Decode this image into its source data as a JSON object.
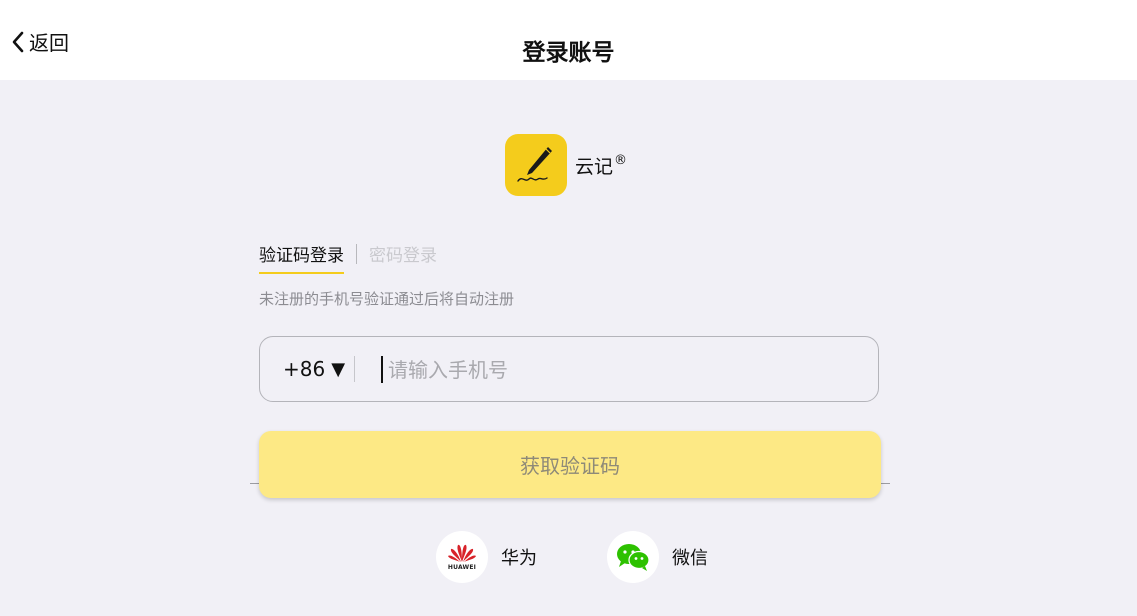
{
  "header": {
    "back_label": "返回",
    "title": "登录账号"
  },
  "app": {
    "name": "云记",
    "registered_mark": "®",
    "logo_icon": "pen-signature-icon",
    "brand_color": "#f4cc1c"
  },
  "tabs": [
    {
      "label": "验证码登录",
      "active": true
    },
    {
      "label": "密码登录",
      "active": false
    }
  ],
  "hint": "未注册的手机号验证通过后将自动注册",
  "phone": {
    "country_code": "+86",
    "caret": "▼",
    "placeholder": "请输入手机号",
    "value": ""
  },
  "get_code_button": {
    "label": "获取验证码",
    "color": "#fde985"
  },
  "social_login": [
    {
      "label": "华为",
      "icon": "huawei-icon",
      "logo_text": "HUAWEI"
    },
    {
      "label": "微信",
      "icon": "wechat-icon"
    }
  ]
}
